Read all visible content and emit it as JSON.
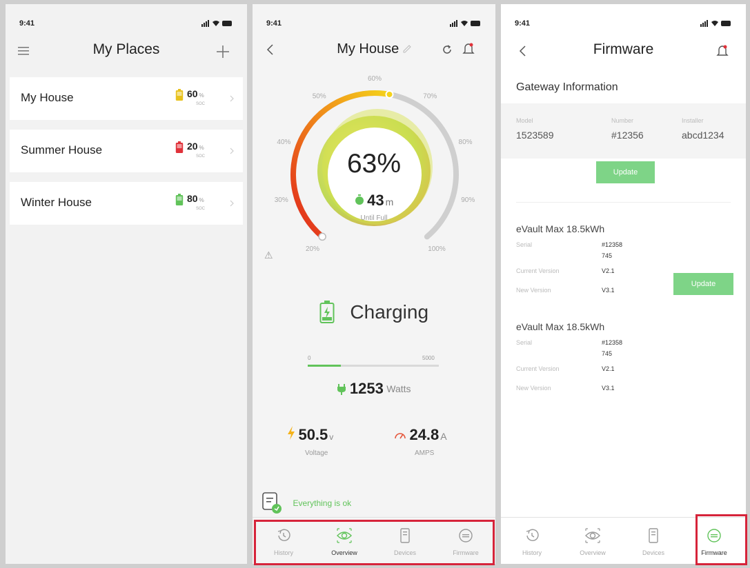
{
  "status": {
    "time": "9:41"
  },
  "screen1": {
    "title": "My Places",
    "places": [
      {
        "name": "My House",
        "percent": "60",
        "unit": "%",
        "soc": "SOC",
        "color": "#e8c21e"
      },
      {
        "name": "Summer House",
        "percent": "20",
        "unit": "%",
        "soc": "SOC",
        "color": "#e0323a"
      },
      {
        "name": "Winter House",
        "percent": "80",
        "unit": "%",
        "soc": "SOC",
        "color": "#61c35a"
      }
    ]
  },
  "screen2": {
    "title": "My House",
    "gauge": {
      "percent": "63%",
      "minutes": "43",
      "minutes_unit": "m",
      "until": "Until Full",
      "level": 0.63,
      "ticks": [
        "20%",
        "30%",
        "40%",
        "50%",
        "60%",
        "70%",
        "80%",
        "90%",
        "100%"
      ]
    },
    "charging": "Charging",
    "power_bar": {
      "min": "0",
      "max": "5000",
      "fraction": 0.25
    },
    "watts": "1253",
    "watts_unit": "Watts",
    "voltage": {
      "value": "50.5",
      "unit": "v",
      "label": "Voltage"
    },
    "amps": {
      "value": "24.8",
      "unit": "A",
      "label": "AMPS"
    },
    "ok_message": "Everything is ok",
    "tabs": [
      "History",
      "Overview",
      "Devices",
      "Firmware"
    ],
    "active_tab": "Overview"
  },
  "screen3": {
    "title": "Firmware",
    "section": "Gateway Information",
    "gateway": {
      "model_label": "Model",
      "model": "1523589",
      "number_label": "Number",
      "number": "#12356",
      "installer_label": "Installer",
      "installer": "abcd1234"
    },
    "update_label": "Update",
    "devices": [
      {
        "name": "eVault Max 18.5kWh",
        "serial_label": "Serial",
        "serial_1": "#12358",
        "serial_2": "745",
        "current_label": "Current Version",
        "current": "V2.1",
        "new_label": "New Version",
        "new": "V3.1"
      },
      {
        "name": "eVault Max 18.5kWh",
        "serial_label": "Serial",
        "serial_1": "#12358",
        "serial_2": "745",
        "current_label": "Current Version",
        "current": "V2.1",
        "new_label": "New Version",
        "new": "V3.1"
      }
    ],
    "tabs": [
      "History",
      "Overview",
      "Devices",
      "Firmware"
    ],
    "active_tab": "Firmware"
  },
  "colors": {
    "accent_green": "#61c35a",
    "highlight_red": "#d6243a"
  }
}
